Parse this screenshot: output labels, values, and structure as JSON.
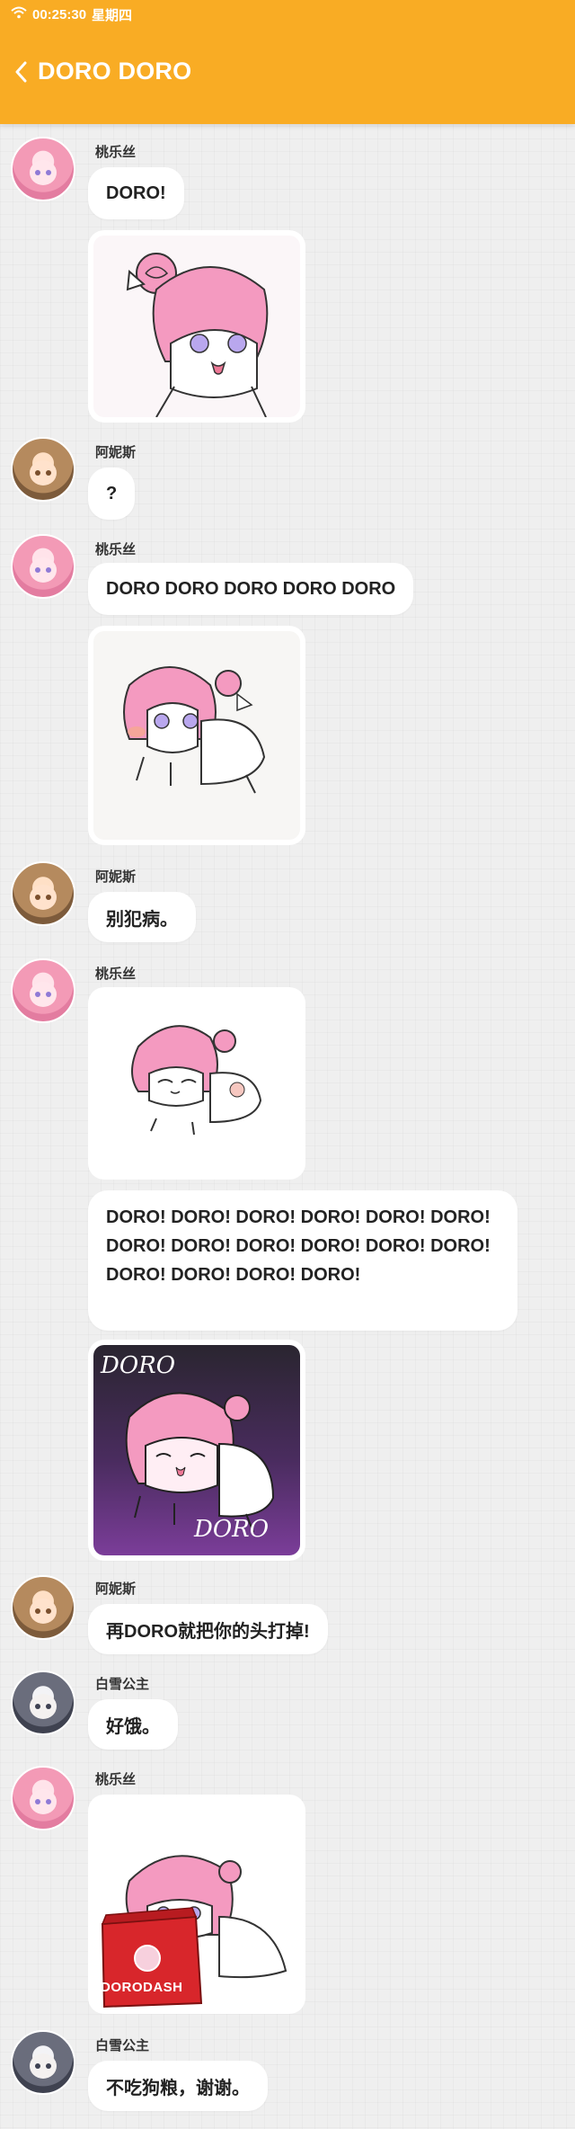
{
  "status_bar": {
    "time": "00:25:30",
    "weekday": "星期四",
    "wifi_icon": "wifi-icon"
  },
  "header": {
    "back_icon": "chevron-left-icon",
    "title": "DORO DORO"
  },
  "colors": {
    "header_bg": "#f9ac24",
    "bubble_bg": "#ffffff",
    "page_bg": "#efefef",
    "doro_pink": "#f49ac0",
    "doro_eye": "#a38fe0"
  },
  "messages": [
    {
      "sender": "桃乐丝",
      "type": "text",
      "text": "DORO!"
    },
    {
      "sender": "桃乐丝",
      "type": "sticker",
      "sticker": "doro-peek-sticker"
    },
    {
      "sender": "阿妮斯",
      "type": "text",
      "text": "?"
    },
    {
      "sender": "桃乐丝",
      "type": "text",
      "text": "DORO DORO DORO DORO DORO"
    },
    {
      "sender": "桃乐丝",
      "type": "sticker",
      "sticker": "doro-crawl-sticker"
    },
    {
      "sender": "阿妮斯",
      "type": "text",
      "text": "别犯病。"
    },
    {
      "sender": "桃乐丝",
      "type": "sticker",
      "sticker": "doro-lying-sticker"
    },
    {
      "sender": "桃乐丝",
      "type": "text",
      "text": "DORO! DORO! DORO! DORO! DORO! DORO! DORO! DORO! DORO! DORO! DORO! DORO! DORO! DORO! DORO! DORO!"
    },
    {
      "sender": "桃乐丝",
      "type": "sticker",
      "sticker": "doro-dark-sticker",
      "sticker_text_top": "DORO",
      "sticker_text_bottom": "DORO"
    },
    {
      "sender": "阿妮斯",
      "type": "text",
      "text": "再DORO就把你的头打掉!"
    },
    {
      "sender": "白雪公主",
      "type": "text",
      "text": "好饿。"
    },
    {
      "sender": "桃乐丝",
      "type": "sticker",
      "sticker": "doro-dash-sticker",
      "sticker_text": "DORODASH"
    },
    {
      "sender": "白雪公主",
      "type": "text",
      "text": "不吃狗粮，谢谢。"
    }
  ]
}
